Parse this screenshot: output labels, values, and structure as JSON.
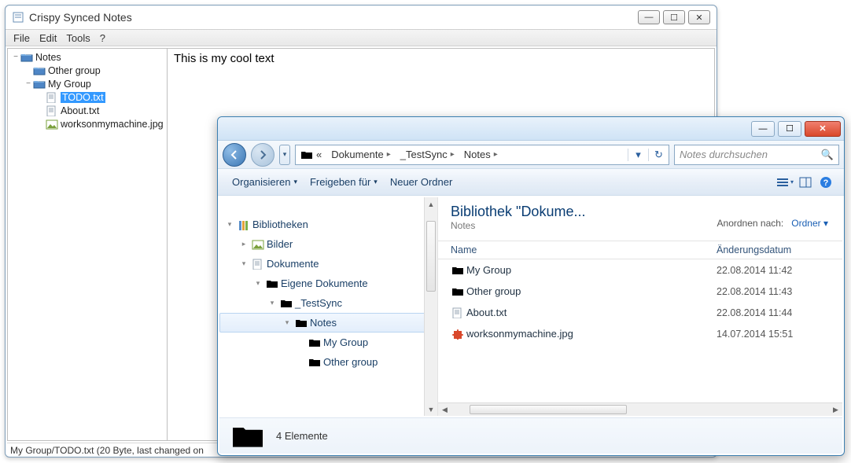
{
  "app": {
    "title": "Crispy Synced Notes",
    "menus": {
      "file": "File",
      "edit": "Edit",
      "tools": "Tools",
      "help": "?"
    },
    "tree": {
      "root": "Notes",
      "items": [
        {
          "label": "Other group",
          "indent": 1,
          "icon": "folder-blue",
          "toggle": ""
        },
        {
          "label": "My Group",
          "indent": 1,
          "icon": "folder-blue",
          "toggle": "−"
        },
        {
          "label": "TODO.txt",
          "indent": 2,
          "icon": "file",
          "selected": true
        },
        {
          "label": "About.txt",
          "indent": 2,
          "icon": "file"
        },
        {
          "label": "worksonmymachine.jpg",
          "indent": 2,
          "icon": "image"
        }
      ]
    },
    "editor_text": "This is my cool text",
    "status": "My Group/TODO.txt (20 Byte, last changed on"
  },
  "explorer": {
    "breadcrumbs": {
      "prefix": "«",
      "seg1": "Dokumente",
      "seg2": "_TestSync",
      "seg3": "Notes"
    },
    "search_placeholder": "Notes durchsuchen",
    "toolbar": {
      "organize": "Organisieren",
      "share": "Freigeben für",
      "newfolder": "Neuer Ordner"
    },
    "navpane": [
      {
        "label": "Bibliotheken",
        "icon": "library",
        "indent": 0,
        "toggle": "▾"
      },
      {
        "label": "Bilder",
        "icon": "pictures",
        "indent": 1,
        "toggle": "▸"
      },
      {
        "label": "Dokumente",
        "icon": "documents",
        "indent": 1,
        "toggle": "▾"
      },
      {
        "label": "Eigene Dokumente",
        "icon": "folder",
        "indent": 2,
        "toggle": "▾"
      },
      {
        "label": "_TestSync",
        "icon": "folder",
        "indent": 3,
        "toggle": "▾"
      },
      {
        "label": "Notes",
        "icon": "folder",
        "indent": 4,
        "toggle": "▾",
        "selected": true
      },
      {
        "label": "My Group",
        "icon": "folder",
        "indent": 5
      },
      {
        "label": "Other group",
        "icon": "folder",
        "indent": 5
      }
    ],
    "header": {
      "title": "Bibliothek \"Dokume...",
      "subtitle": "Notes",
      "arrange_label": "Anordnen nach:",
      "arrange_value": "Ordner"
    },
    "columns": {
      "name": "Name",
      "date": "Änderungsdatum"
    },
    "files": [
      {
        "name": "My Group",
        "icon": "folder",
        "date": "22.08.2014 11:42"
      },
      {
        "name": "Other group",
        "icon": "folder",
        "date": "22.08.2014 11:43"
      },
      {
        "name": "About.txt",
        "icon": "text",
        "date": "22.08.2014 11:44"
      },
      {
        "name": "worksonmymachine.jpg",
        "icon": "puzzle",
        "date": "14.07.2014 15:51"
      }
    ],
    "status": "4 Elemente"
  }
}
